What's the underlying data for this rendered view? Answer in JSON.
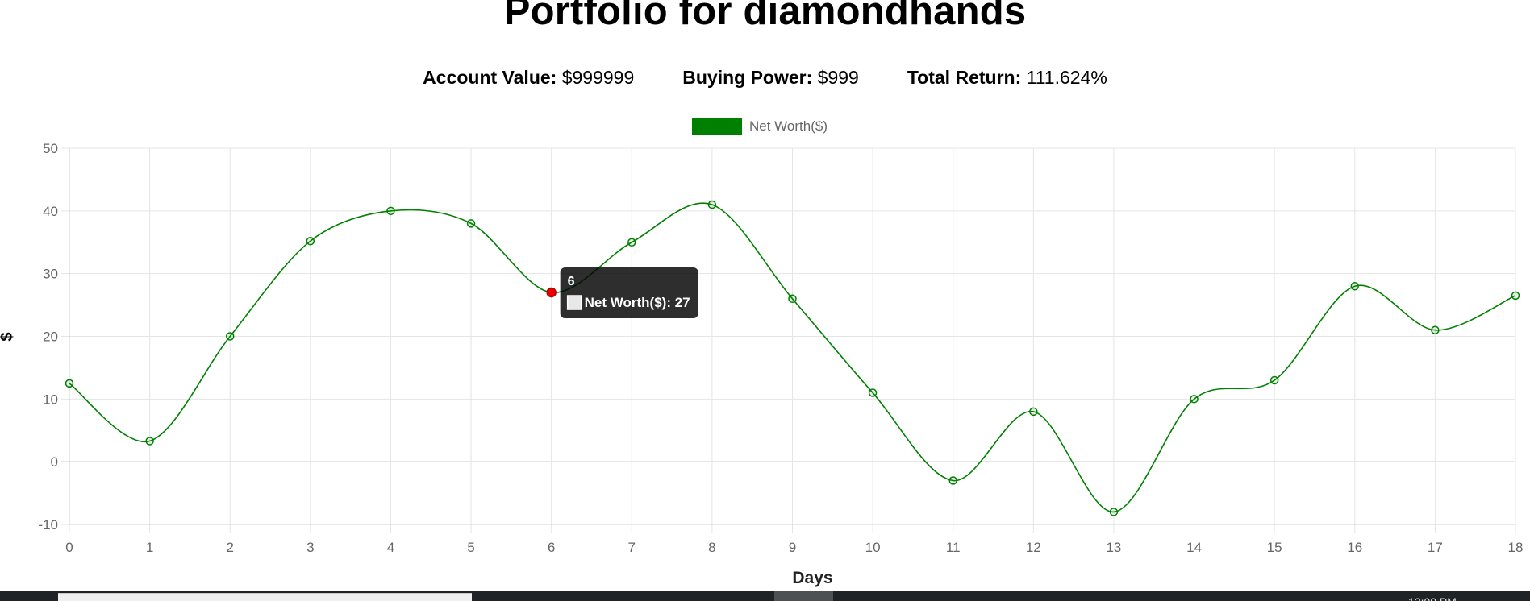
{
  "page": {
    "title": "Portfolio for diamondhands"
  },
  "stats": {
    "account_value_label": "Account Value:",
    "account_value": "$999999",
    "buying_power_label": "Buying Power:",
    "buying_power": "$999",
    "total_return_label": "Total Return:",
    "total_return": "111.624%"
  },
  "chart_data": {
    "type": "line",
    "title": "",
    "xlabel": "Days",
    "ylabel": "$",
    "x": [
      0,
      1,
      2,
      3,
      4,
      5,
      6,
      7,
      8,
      9,
      10,
      11,
      12,
      13,
      14,
      15,
      16,
      17,
      18
    ],
    "series": [
      {
        "name": "Net Worth($)",
        "color": "#008000",
        "values": [
          12.5,
          3.3,
          20,
          35.2,
          40,
          38,
          27,
          35,
          41,
          26,
          11,
          -3,
          8,
          -8,
          10,
          13,
          28,
          21,
          26.5
        ]
      }
    ],
    "ylim": [
      -10,
      50
    ],
    "xlim": [
      0,
      18
    ],
    "yticks": [
      -10,
      0,
      10,
      20,
      30,
      40,
      50
    ],
    "xticks": [
      0,
      1,
      2,
      3,
      4,
      5,
      6,
      7,
      8,
      9,
      10,
      11,
      12,
      13,
      14,
      15,
      16,
      17,
      18
    ],
    "grid": true,
    "legend": "top-center",
    "highlight_color": "#e60000"
  },
  "tooltip": {
    "title": "6",
    "label": "Net Worth($): 27"
  }
}
